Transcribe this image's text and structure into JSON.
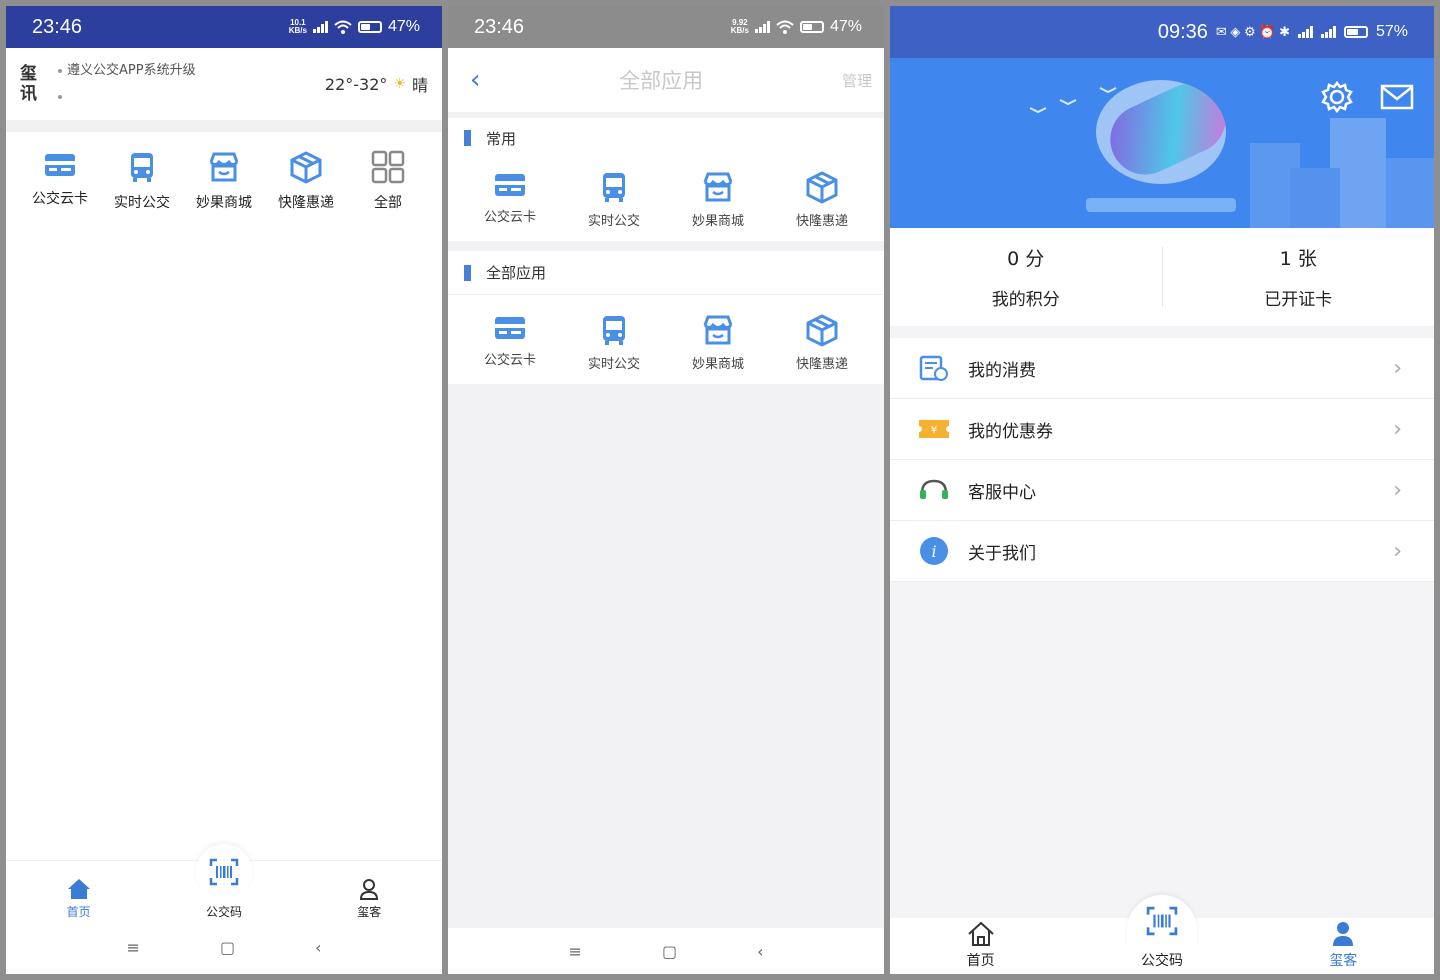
{
  "screen1": {
    "status": {
      "time": "23:46",
      "net_top": "10.1",
      "net_bottom": "KB/s",
      "battery": "47%"
    },
    "news": {
      "logo_top": "玺",
      "logo_bottom": "讯",
      "items": [
        "遵义公交APP系统升级",
        ""
      ]
    },
    "weather": {
      "temp": "22°-32°",
      "condition": "晴"
    },
    "apps": [
      "公交云卡",
      "实时公交",
      "妙果商城",
      "快隆惠递",
      "全部"
    ],
    "tabs": {
      "home": "首页",
      "code": "公交码",
      "me": "玺客"
    },
    "navbar": {
      "menu": "≡",
      "home": "▢",
      "back": "‹"
    }
  },
  "screen2": {
    "status": {
      "time": "23:46",
      "net_top": "9.92",
      "net_bottom": "KB/s",
      "battery": "47%"
    },
    "header": {
      "back": "‹",
      "title": "全部应用",
      "manage": "管理"
    },
    "sections": [
      {
        "title": "常用",
        "apps": [
          "公交云卡",
          "实时公交",
          "妙果商城",
          "快隆惠递"
        ]
      },
      {
        "title": "全部应用",
        "apps": [
          "公交云卡",
          "实时公交",
          "妙果商城",
          "快隆惠递"
        ]
      }
    ],
    "navbar": {
      "menu": "≡",
      "home": "▢",
      "back": "‹"
    }
  },
  "screen3": {
    "status": {
      "time": "09:36",
      "battery": "57%"
    },
    "stats": [
      {
        "value": "0 分",
        "label": "我的积分"
      },
      {
        "value": "1 张",
        "label": "已开证卡"
      }
    ],
    "menu": [
      "我的消费",
      "我的优惠券",
      "客服中心",
      "关于我们"
    ],
    "tabs": {
      "home": "首页",
      "code": "公交码",
      "me": "玺客"
    },
    "colors": {
      "accent": "#3a7bd5",
      "hero": "#3f86ee",
      "status": "#3d61c4"
    }
  }
}
